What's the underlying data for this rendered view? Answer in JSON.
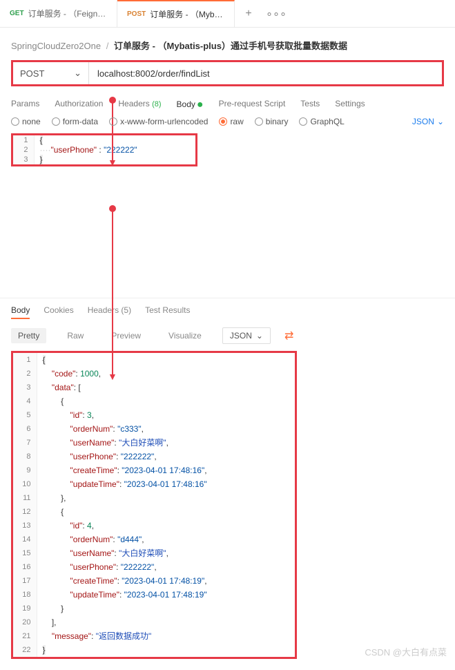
{
  "tabs": {
    "tab1": {
      "method": "GET",
      "title": "订单服务 - （Feign）演示"
    },
    "tab2": {
      "method": "POST",
      "title": "订单服务 - （Mybatis-pl"
    }
  },
  "breadcrumb": {
    "collection": "SpringCloudZero2One",
    "sep": "/",
    "name": "订单服务 - （Mybatis-plus）通过手机号获取批量数据数据"
  },
  "request": {
    "method": "POST",
    "url": "localhost:8002/order/findList",
    "tabs": {
      "params": "Params",
      "auth": "Authorization",
      "headers": "Headers",
      "headers_count": "(8)",
      "body": "Body",
      "prereq": "Pre-request Script",
      "tests": "Tests",
      "settings": "Settings"
    },
    "body_types": {
      "none": "none",
      "form": "form-data",
      "xform": "x-www-form-urlencoded",
      "raw": "raw",
      "binary": "binary",
      "graphql": "GraphQL"
    },
    "format": "JSON",
    "body_lines": {
      "l1_open": "{",
      "l2_key": "\"userPhone\"",
      "l2_colon": " : ",
      "l2_val": "\"222222\"",
      "l3_close": "}"
    }
  },
  "response": {
    "tabs": {
      "body": "Body",
      "cookies": "Cookies",
      "headers": "Headers",
      "headers_count": "(5)",
      "tests": "Test Results"
    },
    "views": {
      "pretty": "Pretty",
      "raw": "Raw",
      "preview": "Preview",
      "visualize": "Visualize"
    },
    "format": "JSON",
    "data": {
      "code": 1000,
      "data": [
        {
          "id": 3,
          "orderNum": "c333",
          "userName": "大白好菜啊",
          "userPhone": "222222",
          "createTime": "2023-04-01 17:48:16",
          "updateTime": "2023-04-01 17:48:16"
        },
        {
          "id": 4,
          "orderNum": "d444",
          "userName": "大白好菜啊",
          "userPhone": "222222",
          "createTime": "2023-04-01 17:48:19",
          "updateTime": "2023-04-01 17:48:19"
        }
      ],
      "message": "返回数据成功"
    }
  },
  "watermark": "CSDN @大白有点菜"
}
